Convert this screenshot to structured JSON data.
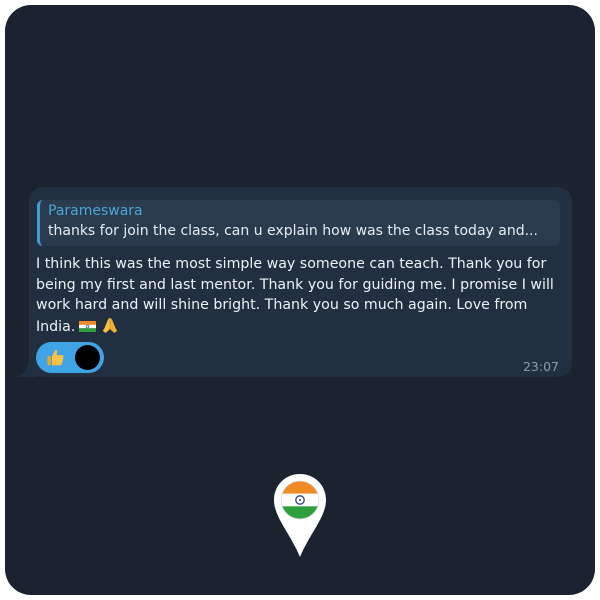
{
  "message": {
    "reply": {
      "author": "Parameswara",
      "text": "thanks for join the class, can u explain how was the class today and..."
    },
    "text": "I think this was the most simple way someone can teach. Thank you for being my first and last mentor. Thank you for guiding me. I promise I will work hard and will shine bright. Thank you so much again. Love from India.",
    "trailing_emojis": [
      "flag-india-icon",
      "folded-hands-icon"
    ],
    "reaction": {
      "emoji": "thumbs-up-icon",
      "count_avatars": 1
    },
    "time": "23:07"
  },
  "location_pin": {
    "flag": "india-flag"
  },
  "colors": {
    "background": "#1b2330",
    "bubble": "#212f40",
    "reply_bar": "#3ea1d6",
    "reply_author": "#47a6d9",
    "reaction_pill": "#3fa4e6",
    "timestamp": "#8c9aac"
  }
}
